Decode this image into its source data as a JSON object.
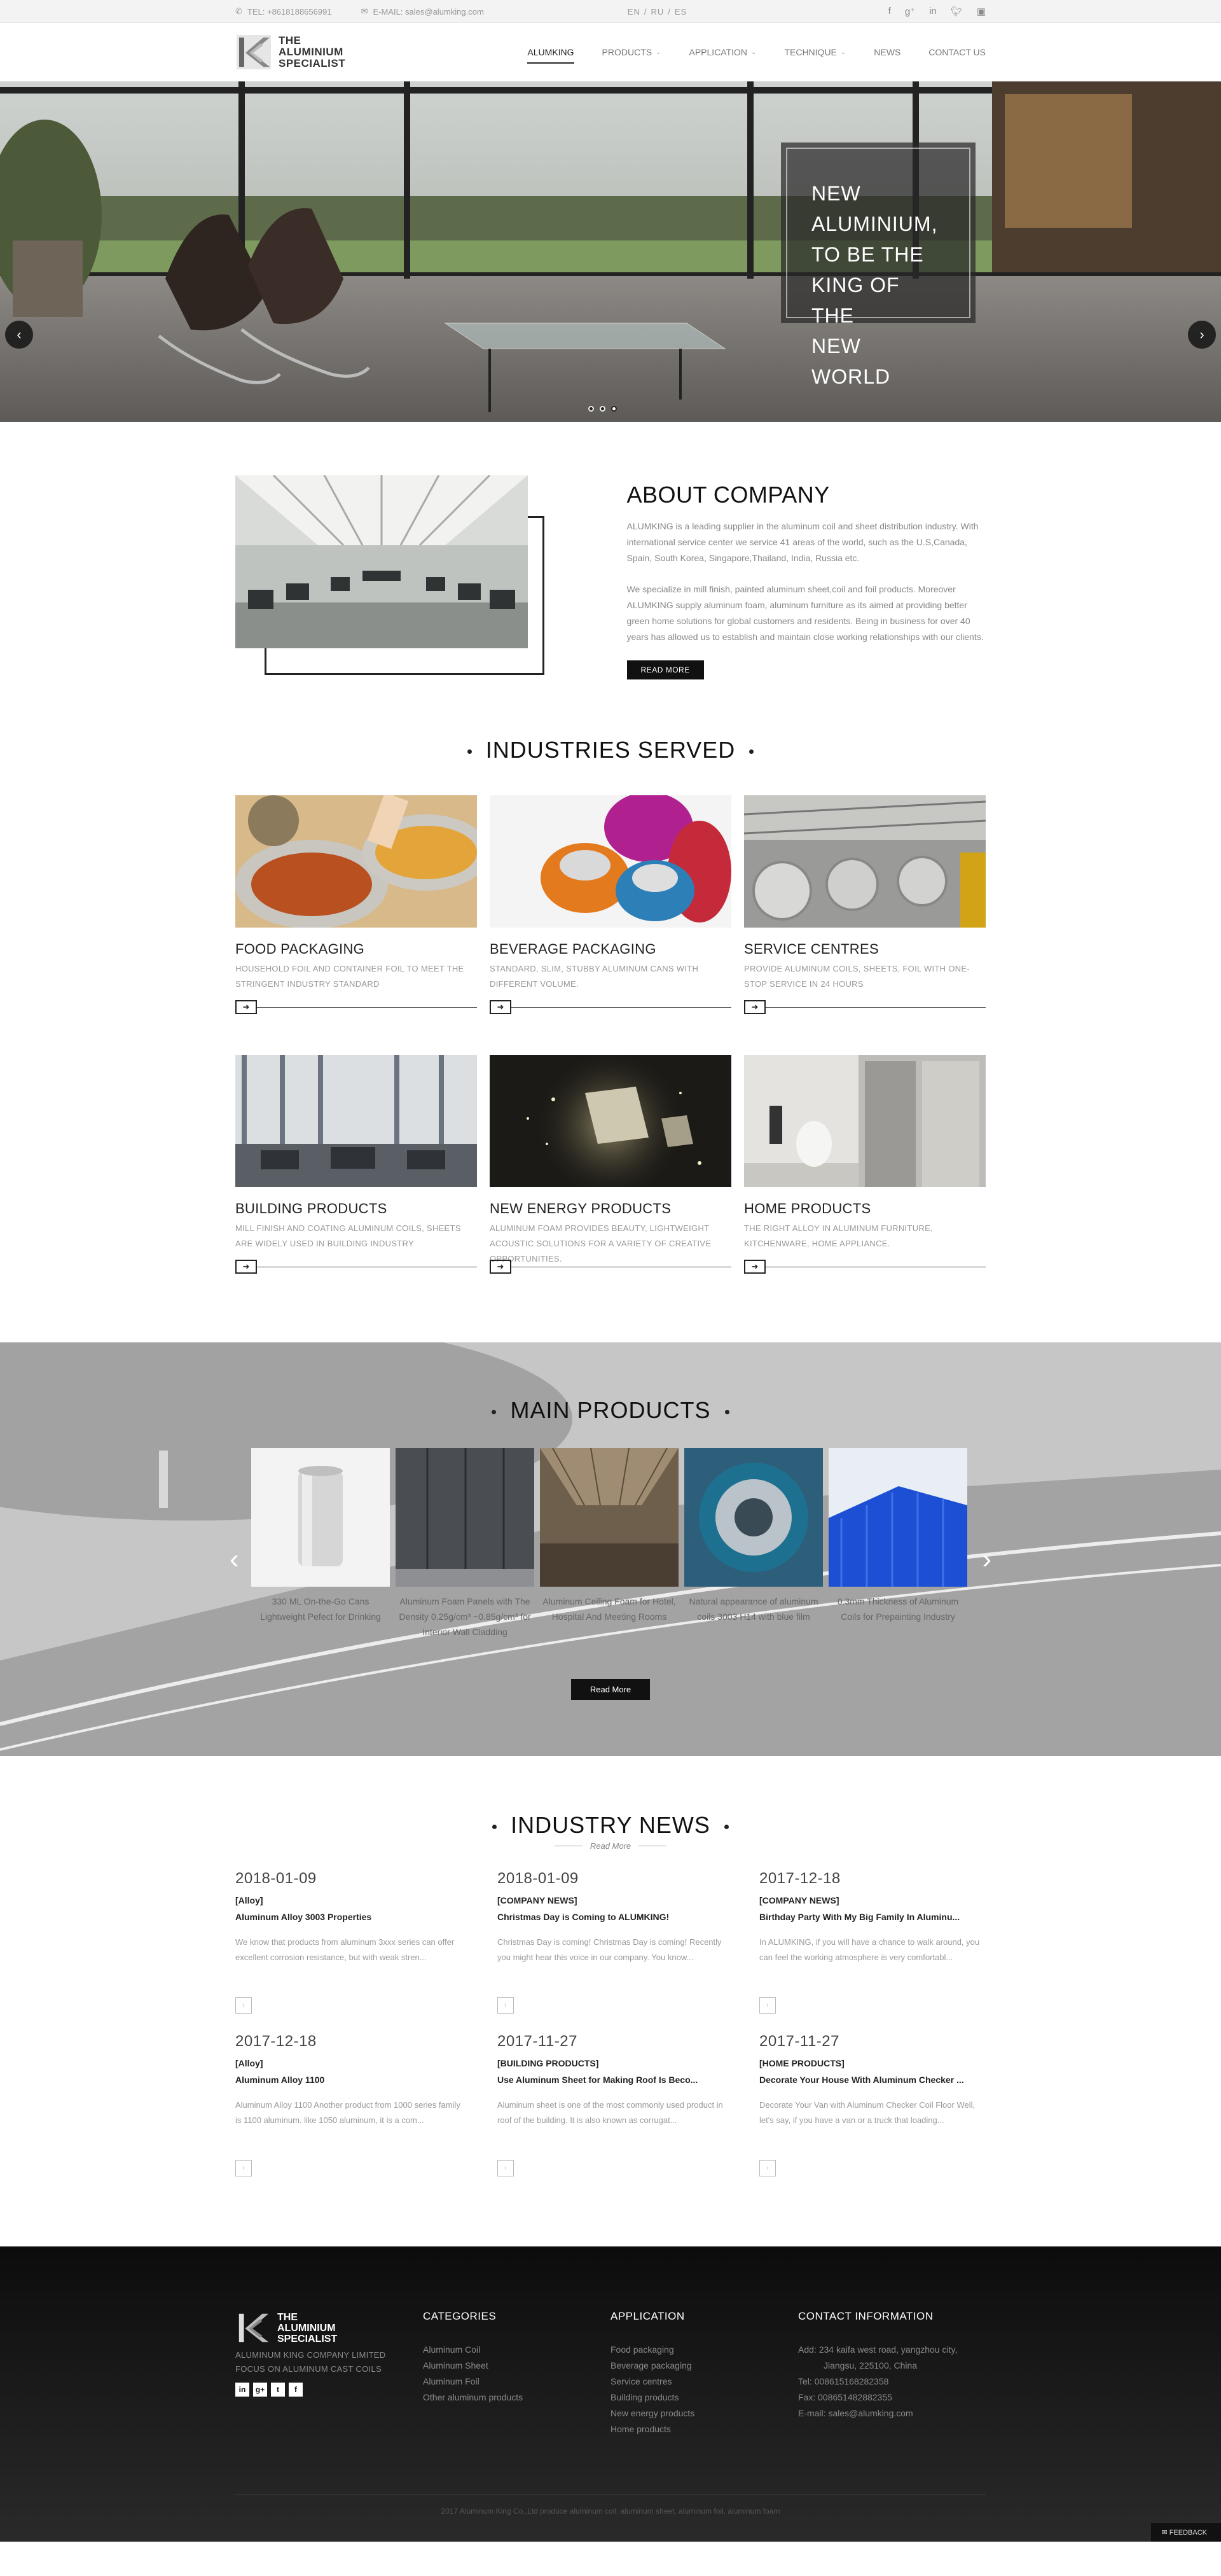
{
  "topbar": {
    "tel": "TEL: +8618188656991",
    "email": "E-MAIL: sales@alumking.com",
    "langs": [
      "EN",
      "/",
      "RU",
      "/",
      "ES"
    ],
    "social_icons": [
      "facebook-icon",
      "google-plus-icon",
      "linkedin-icon",
      "twitter-icon",
      "youtube-icon"
    ]
  },
  "header": {
    "logo_text": [
      "THE",
      "ALUMINIUM",
      "SPECIALIST"
    ],
    "nav": [
      {
        "label": "ALUMKING",
        "dropdown": false
      },
      {
        "label": "PRODUCTS",
        "dropdown": true
      },
      {
        "label": "APPLICATION",
        "dropdown": true
      },
      {
        "label": "TECHNIQUE",
        "dropdown": true
      },
      {
        "label": "NEWS",
        "dropdown": false
      },
      {
        "label": "CONTACT US",
        "dropdown": false
      }
    ]
  },
  "hero": {
    "title": [
      "NEW",
      "ALUMINIUM,",
      "TO BE THE",
      "KING OF THE",
      "NEW WORLD"
    ],
    "prev": "‹",
    "next": "›"
  },
  "about": {
    "title": "ABOUT COMPANY",
    "p1": "ALUMKING is a leading supplier in the aluminum coil and sheet distribution industry. With international service center we service 41 areas of the world, such as the U.S,Canada, Spain, South Korea, Singapore,Thailand, India, Russia etc.",
    "p2": "We specialize in mill finish, painted aluminum sheet,coil and foil products. Moreover ALUMKING supply aluminum foam, aluminum furniture as its aimed at providing better green home solutions for global customers and residents. Being in business for over 40 years has allowed us to establish and maintain close working relationships with our clients.",
    "button": "READ MORE"
  },
  "industries": {
    "title": "INDUSTRIES SERVED",
    "items": [
      {
        "title": "FOOD PACKAGING",
        "desc": "HOUSEHOLD FOIL AND CONTAINER FOIL TO MEET THE STRINGENT INDUSTRY STANDARD"
      },
      {
        "title": "BEVERAGE PACKAGING",
        "desc": "STANDARD, SLIM, STUBBY ALUMINUM CANS WITH DIFFERENT VOLUME."
      },
      {
        "title": "SERVICE CENTRES",
        "desc": "PROVIDE ALUMINUM COILS, SHEETS, FOIL WITH ONE-STOP SERVICE IN 24 HOURS"
      },
      {
        "title": "BUILDING PRODUCTS",
        "desc": "MILL FINISH AND COATING ALUMINUM COILS, SHEETS ARE WIDELY USED IN BUILDING INDUSTRY"
      },
      {
        "title": "NEW ENERGY PRODUCTS",
        "desc": "ALUMINUM FOAM PROVIDES BEAUTY, LIGHTWEIGHT ACOUSTIC SOLUTIONS FOR A VARIETY OF CREATIVE OPPORTUNITIES."
      },
      {
        "title": "HOME PRODUCTS",
        "desc": "THE RIGHT ALLOY IN ALUMINUM FURNITURE, KITCHENWARE, HOME APPLIANCE."
      }
    ]
  },
  "products": {
    "title": "MAIN PRODUCTS",
    "items": [
      {
        "caption": "330 ML On-the-Go Cans Lightweight Pefect for Drinking"
      },
      {
        "caption": "Aluminum Foam Panels with The Density 0.25g/cm³ ~0.85g/cm³ for Interior Wall Cladding"
      },
      {
        "caption": "Aluminum Ceiling Foam for Hotel, Hospital And Meeting Rooms"
      },
      {
        "caption": "Natural appearance of aluminum coils 3003 H14 with blue film"
      },
      {
        "caption": "0.3mm Thickness of Aluminum Coils for Prepainting Industry"
      }
    ],
    "button": "Read More"
  },
  "news": {
    "title": "INDUSTRY NEWS",
    "read_more": "Read More",
    "items": [
      {
        "date": "2018-01-09",
        "category": "[Alloy]",
        "headline": "Aluminum Alloy 3003 Properties",
        "excerpt": "We know that products from aluminum 3xxx series can offer excellent corrosion resistance, but with weak stren..."
      },
      {
        "date": "2018-01-09",
        "category": "[COMPANY NEWS]",
        "headline": "Christmas Day is Coming to ALUMKING!",
        "excerpt": "Christmas Day is coming! Christmas Day is coming! Recently you might hear this voice in our company. You know..."
      },
      {
        "date": "2017-12-18",
        "category": "[COMPANY NEWS]",
        "headline": "Birthday Party With My Big Family In Aluminu...",
        "excerpt": "In ALUMKING, if you will have a chance to walk around, you can feel the working atmosphere is very comfortabl..."
      },
      {
        "date": "2017-12-18",
        "category": "[Alloy]",
        "headline": "Aluminum Alloy 1100",
        "excerpt": "Aluminum Alloy 1100 Another product from 1000 series family is 1100 aluminum. like 1050 aluminum, it is a com..."
      },
      {
        "date": "2017-11-27",
        "category": "[BUILDING PRODUCTS]",
        "headline": "Use Aluminum Sheet for Making Roof Is Beco...",
        "excerpt": "Aluminum sheet is one of the most commonly used product in roof of the building. It is also known as corrugat..."
      },
      {
        "date": "2017-11-27",
        "category": "[HOME PRODUCTS]",
        "headline": "Decorate Your House With Aluminum Checker ...",
        "excerpt": "Decorate Your Van with Aluminum Checker Coil Floor Well, let's say, if you have a van or a truck that loading..."
      }
    ]
  },
  "footer": {
    "logo_text": [
      "THE",
      "ALUMINIUM",
      "SPECIALIST"
    ],
    "tagline": [
      "ALUMINUM KING COMPANY LIMITED",
      "FOCUS ON ALUMINUM CAST COILS"
    ],
    "social": [
      "in",
      "g+",
      "t",
      "f"
    ],
    "categories": {
      "title": "CATEGORIES",
      "items": [
        "Aluminum Coil",
        "Aluminum Sheet",
        "Aluminum Foil",
        "Other aluminum products"
      ]
    },
    "application": {
      "title": "APPLICATION",
      "items": [
        "Food packaging",
        "Beverage packaging",
        "Service centres",
        "Building products",
        "New energy products",
        "Home products"
      ]
    },
    "contact": {
      "title": "CONTACT INFORMATION",
      "items": [
        "Add: 234 kaifa west road, yangzhou city,",
        "Jiangsu, 225100, China",
        "Tel: 008615168282358",
        "Fax: 008651482882355",
        "E-mail: sales@alumking.com"
      ]
    },
    "copyright": "2017 Aluminum King Co.,Ltd produce aluminum coil, aluminum sheet, aluminum foil, aluminum foam",
    "feedback": "FEEDBACK"
  }
}
